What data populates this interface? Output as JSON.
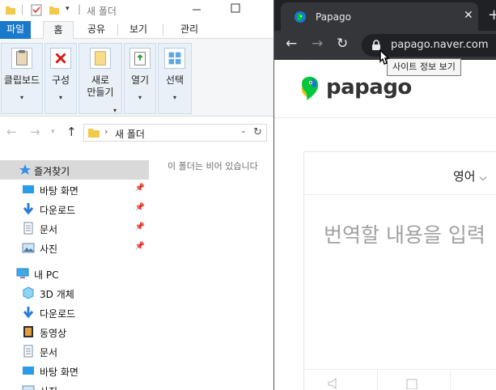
{
  "explorer": {
    "title": "새 폴더",
    "ribbon_tabs": [
      "파일",
      "홈",
      "공유",
      "보기",
      "관리"
    ],
    "ribbon_groups": [
      {
        "label": "클립보드",
        "icon": "clipboard-icon"
      },
      {
        "label": "구성",
        "icon": "organize-icon"
      },
      {
        "label": "새로\n만들기",
        "icon": "new-folder-icon"
      },
      {
        "label": "열기",
        "icon": "open-icon"
      },
      {
        "label": "선택",
        "icon": "select-icon"
      }
    ],
    "address": {
      "folder": "새 폴더"
    },
    "nav_items": [
      {
        "label": "즐겨찾기",
        "icon": "star-icon",
        "selected": true,
        "pinned": false
      },
      {
        "label": "바탕 화면",
        "icon": "desktop-icon",
        "selected": false,
        "pinned": true
      },
      {
        "label": "다운로드",
        "icon": "download-icon",
        "selected": false,
        "pinned": true
      },
      {
        "label": "문서",
        "icon": "document-icon",
        "selected": false,
        "pinned": true
      },
      {
        "label": "사진",
        "icon": "picture-icon",
        "selected": false,
        "pinned": true
      },
      {
        "label": "내 PC",
        "icon": "pc-icon",
        "selected": false,
        "pinned": false
      },
      {
        "label": "3D 개체",
        "icon": "cube-icon",
        "selected": false,
        "pinned": false
      },
      {
        "label": "다운로드",
        "icon": "download-icon",
        "selected": false,
        "pinned": false
      },
      {
        "label": "동영상",
        "icon": "video-icon",
        "selected": false,
        "pinned": false
      },
      {
        "label": "문서",
        "icon": "document-icon",
        "selected": false,
        "pinned": false
      },
      {
        "label": "바탕 화면",
        "icon": "desktop-icon",
        "selected": false,
        "pinned": false
      },
      {
        "label": "사진",
        "icon": "picture-icon",
        "selected": false,
        "pinned": false
      }
    ],
    "empty_message": "이 폴더는 비어 있습니다"
  },
  "chrome": {
    "tab_title": "Papago",
    "url": "papago.naver.com",
    "tooltip": "사이트 정보 보기",
    "page": {
      "logo_text": "papago",
      "source_language": "영어",
      "placeholder": "번역할 내용을 입력"
    }
  },
  "colors": {
    "explorer_accent": "#1979ca",
    "chrome_dark": "#202124",
    "chrome_toolbar": "#35363a",
    "papago_green": "#00c73c",
    "papago_blue": "#1976d2"
  }
}
